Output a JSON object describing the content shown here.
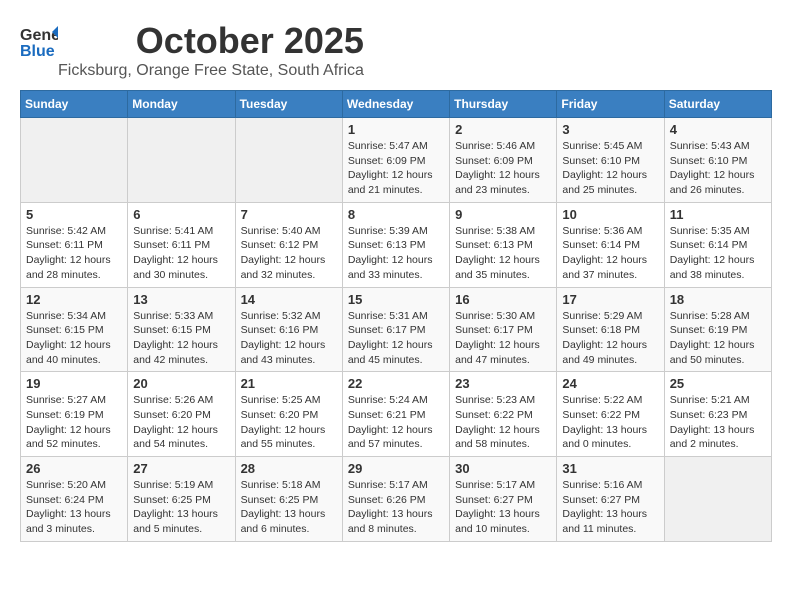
{
  "header": {
    "logo_general": "General",
    "logo_blue": "Blue",
    "month": "October 2025",
    "location": "Ficksburg, Orange Free State, South Africa"
  },
  "days_of_week": [
    "Sunday",
    "Monday",
    "Tuesday",
    "Wednesday",
    "Thursday",
    "Friday",
    "Saturday"
  ],
  "weeks": [
    [
      {
        "day": "",
        "info": ""
      },
      {
        "day": "",
        "info": ""
      },
      {
        "day": "",
        "info": ""
      },
      {
        "day": "1",
        "info": "Sunrise: 5:47 AM\nSunset: 6:09 PM\nDaylight: 12 hours\nand 21 minutes."
      },
      {
        "day": "2",
        "info": "Sunrise: 5:46 AM\nSunset: 6:09 PM\nDaylight: 12 hours\nand 23 minutes."
      },
      {
        "day": "3",
        "info": "Sunrise: 5:45 AM\nSunset: 6:10 PM\nDaylight: 12 hours\nand 25 minutes."
      },
      {
        "day": "4",
        "info": "Sunrise: 5:43 AM\nSunset: 6:10 PM\nDaylight: 12 hours\nand 26 minutes."
      }
    ],
    [
      {
        "day": "5",
        "info": "Sunrise: 5:42 AM\nSunset: 6:11 PM\nDaylight: 12 hours\nand 28 minutes."
      },
      {
        "day": "6",
        "info": "Sunrise: 5:41 AM\nSunset: 6:11 PM\nDaylight: 12 hours\nand 30 minutes."
      },
      {
        "day": "7",
        "info": "Sunrise: 5:40 AM\nSunset: 6:12 PM\nDaylight: 12 hours\nand 32 minutes."
      },
      {
        "day": "8",
        "info": "Sunrise: 5:39 AM\nSunset: 6:13 PM\nDaylight: 12 hours\nand 33 minutes."
      },
      {
        "day": "9",
        "info": "Sunrise: 5:38 AM\nSunset: 6:13 PM\nDaylight: 12 hours\nand 35 minutes."
      },
      {
        "day": "10",
        "info": "Sunrise: 5:36 AM\nSunset: 6:14 PM\nDaylight: 12 hours\nand 37 minutes."
      },
      {
        "day": "11",
        "info": "Sunrise: 5:35 AM\nSunset: 6:14 PM\nDaylight: 12 hours\nand 38 minutes."
      }
    ],
    [
      {
        "day": "12",
        "info": "Sunrise: 5:34 AM\nSunset: 6:15 PM\nDaylight: 12 hours\nand 40 minutes."
      },
      {
        "day": "13",
        "info": "Sunrise: 5:33 AM\nSunset: 6:15 PM\nDaylight: 12 hours\nand 42 minutes."
      },
      {
        "day": "14",
        "info": "Sunrise: 5:32 AM\nSunset: 6:16 PM\nDaylight: 12 hours\nand 43 minutes."
      },
      {
        "day": "15",
        "info": "Sunrise: 5:31 AM\nSunset: 6:17 PM\nDaylight: 12 hours\nand 45 minutes."
      },
      {
        "day": "16",
        "info": "Sunrise: 5:30 AM\nSunset: 6:17 PM\nDaylight: 12 hours\nand 47 minutes."
      },
      {
        "day": "17",
        "info": "Sunrise: 5:29 AM\nSunset: 6:18 PM\nDaylight: 12 hours\nand 49 minutes."
      },
      {
        "day": "18",
        "info": "Sunrise: 5:28 AM\nSunset: 6:19 PM\nDaylight: 12 hours\nand 50 minutes."
      }
    ],
    [
      {
        "day": "19",
        "info": "Sunrise: 5:27 AM\nSunset: 6:19 PM\nDaylight: 12 hours\nand 52 minutes."
      },
      {
        "day": "20",
        "info": "Sunrise: 5:26 AM\nSunset: 6:20 PM\nDaylight: 12 hours\nand 54 minutes."
      },
      {
        "day": "21",
        "info": "Sunrise: 5:25 AM\nSunset: 6:20 PM\nDaylight: 12 hours\nand 55 minutes."
      },
      {
        "day": "22",
        "info": "Sunrise: 5:24 AM\nSunset: 6:21 PM\nDaylight: 12 hours\nand 57 minutes."
      },
      {
        "day": "23",
        "info": "Sunrise: 5:23 AM\nSunset: 6:22 PM\nDaylight: 12 hours\nand 58 minutes."
      },
      {
        "day": "24",
        "info": "Sunrise: 5:22 AM\nSunset: 6:22 PM\nDaylight: 13 hours\nand 0 minutes."
      },
      {
        "day": "25",
        "info": "Sunrise: 5:21 AM\nSunset: 6:23 PM\nDaylight: 13 hours\nand 2 minutes."
      }
    ],
    [
      {
        "day": "26",
        "info": "Sunrise: 5:20 AM\nSunset: 6:24 PM\nDaylight: 13 hours\nand 3 minutes."
      },
      {
        "day": "27",
        "info": "Sunrise: 5:19 AM\nSunset: 6:25 PM\nDaylight: 13 hours\nand 5 minutes."
      },
      {
        "day": "28",
        "info": "Sunrise: 5:18 AM\nSunset: 6:25 PM\nDaylight: 13 hours\nand 6 minutes."
      },
      {
        "day": "29",
        "info": "Sunrise: 5:17 AM\nSunset: 6:26 PM\nDaylight: 13 hours\nand 8 minutes."
      },
      {
        "day": "30",
        "info": "Sunrise: 5:17 AM\nSunset: 6:27 PM\nDaylight: 13 hours\nand 10 minutes."
      },
      {
        "day": "31",
        "info": "Sunrise: 5:16 AM\nSunset: 6:27 PM\nDaylight: 13 hours\nand 11 minutes."
      },
      {
        "day": "",
        "info": ""
      }
    ]
  ]
}
